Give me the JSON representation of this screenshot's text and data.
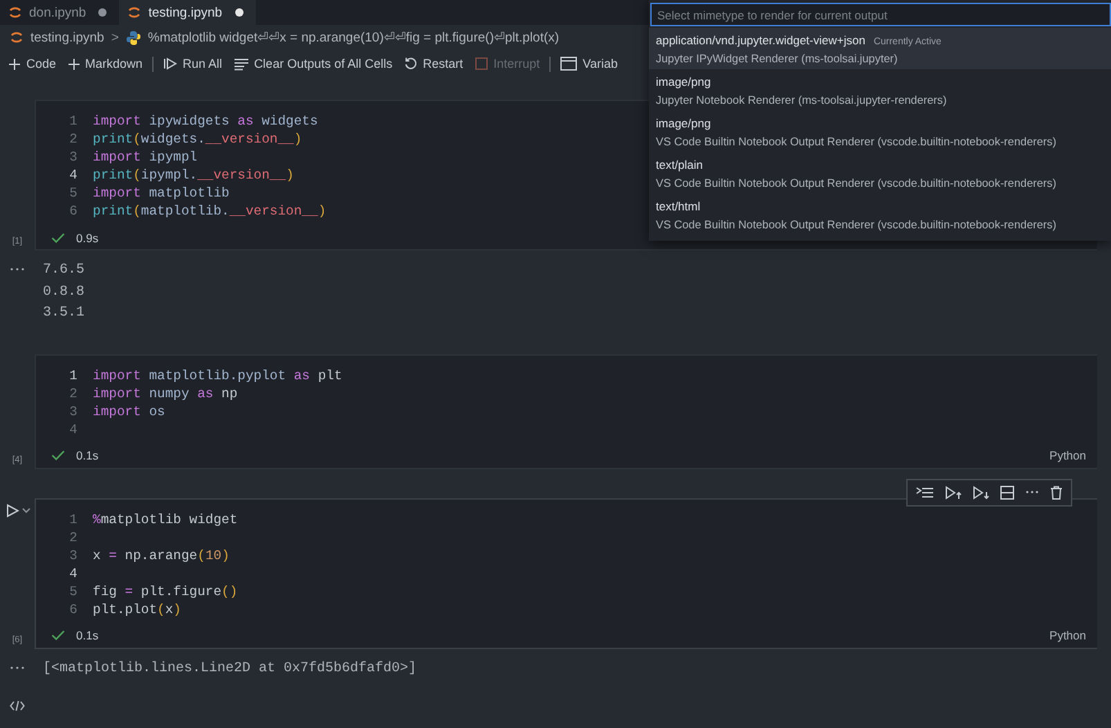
{
  "tabs": [
    {
      "label": "don.ipynb",
      "selected": false,
      "modified": true
    },
    {
      "label": "testing.ipynb",
      "selected": true,
      "modified": true
    }
  ],
  "breadcrumb": {
    "file": "testing.ipynb",
    "separator": ">",
    "cell": "%matplotlib widget⏎⏎x = np.arange(10)⏎⏎fig = plt.figure()⏎plt.plot(x)"
  },
  "toolbar": [
    {
      "kind": "add",
      "label": "Code",
      "disabled": false
    },
    {
      "kind": "add",
      "label": "Markdown",
      "disabled": false
    },
    {
      "kind": "separator"
    },
    {
      "kind": "run-all",
      "label": "Run All",
      "disabled": false
    },
    {
      "kind": "clear",
      "label": "Clear Outputs of All Cells",
      "disabled": false
    },
    {
      "kind": "restart",
      "label": "Restart",
      "disabled": false
    },
    {
      "kind": "interrupt",
      "label": "Interrupt",
      "disabled": true
    },
    {
      "kind": "separator"
    },
    {
      "kind": "variables",
      "label": "Variab",
      "disabled": false
    }
  ],
  "cells": [
    {
      "execution_count": "[1]",
      "time": "0.9s",
      "focused": false,
      "lines": [
        {
          "number": "1",
          "active": false,
          "tokens": [
            {
              "text": "import",
              "kind": "kw"
            },
            {
              "text": " ipywidgets ",
              "kind": "name"
            },
            {
              "text": "as",
              "kind": "kw"
            },
            {
              "text": " widgets",
              "kind": "name"
            }
          ]
        },
        {
          "number": "2",
          "active": false,
          "tokens": [
            {
              "text": "print",
              "kind": "func"
            },
            {
              "text": "(",
              "kind": "paren"
            },
            {
              "text": "widgets.",
              "kind": "name"
            },
            {
              "text": "__version__",
              "kind": "dunder"
            },
            {
              "text": ")",
              "kind": "paren"
            }
          ]
        },
        {
          "number": "3",
          "active": false,
          "tokens": [
            {
              "text": "import",
              "kind": "kw"
            },
            {
              "text": " ipympl",
              "kind": "name"
            }
          ]
        },
        {
          "number": "4",
          "active": true,
          "tokens": [
            {
              "text": "print",
              "kind": "func"
            },
            {
              "text": "(",
              "kind": "paren"
            },
            {
              "text": "ipympl.",
              "kind": "name"
            },
            {
              "text": "__version__",
              "kind": "dunder"
            },
            {
              "text": ")",
              "kind": "paren"
            }
          ]
        },
        {
          "number": "5",
          "active": false,
          "tokens": [
            {
              "text": "import",
              "kind": "kw"
            },
            {
              "text": " matplotlib",
              "kind": "name"
            }
          ]
        },
        {
          "number": "6",
          "active": false,
          "tokens": [
            {
              "text": "print",
              "kind": "func"
            },
            {
              "text": "(",
              "kind": "paren"
            },
            {
              "text": "matplotlib.",
              "kind": "name"
            },
            {
              "text": "__version__",
              "kind": "dunder"
            },
            {
              "text": ")",
              "kind": "paren"
            }
          ]
        }
      ],
      "outputs": [
        "7.6.5",
        "0.8.8",
        "3.5.1"
      ]
    },
    {
      "execution_count": "[4]",
      "time": "0.1s",
      "language": "Python",
      "focused": false,
      "lines": [
        {
          "number": "1",
          "active": true,
          "tokens": [
            {
              "text": "import",
              "kind": "kw"
            },
            {
              "text": " matplotlib.pyplot ",
              "kind": "name"
            },
            {
              "text": "as",
              "kind": "kw"
            },
            {
              "text": " plt",
              "kind": "plain"
            }
          ]
        },
        {
          "number": "2",
          "active": false,
          "tokens": [
            {
              "text": "import",
              "kind": "kw"
            },
            {
              "text": " numpy ",
              "kind": "name"
            },
            {
              "text": "as",
              "kind": "kw"
            },
            {
              "text": " np",
              "kind": "plain"
            }
          ]
        },
        {
          "number": "3",
          "active": false,
          "tokens": [
            {
              "text": "import",
              "kind": "kw"
            },
            {
              "text": " os",
              "kind": "name"
            }
          ]
        },
        {
          "number": "4",
          "active": false
        }
      ]
    },
    {
      "execution_count": "[6]",
      "time": "0.1s",
      "language": "Python",
      "focused": true,
      "lines": [
        {
          "number": "1",
          "active": false,
          "tokens": [
            {
              "text": "%",
              "kind": "kw"
            },
            {
              "text": "matplotlib widget",
              "kind": "plain"
            }
          ]
        },
        {
          "number": "2",
          "active": false
        },
        {
          "number": "3",
          "active": false,
          "tokens": [
            {
              "text": "x ",
              "kind": "plain"
            },
            {
              "text": "=",
              "kind": "kw"
            },
            {
              "text": " np.arange",
              "kind": "plain"
            },
            {
              "text": "(",
              "kind": "paren"
            },
            {
              "text": "10",
              "kind": "number"
            },
            {
              "text": ")",
              "kind": "paren"
            }
          ]
        },
        {
          "number": "4",
          "active": true
        },
        {
          "number": "5",
          "active": false,
          "tokens": [
            {
              "text": "fig ",
              "kind": "plain"
            },
            {
              "text": "=",
              "kind": "kw"
            },
            {
              "text": " plt.figure",
              "kind": "plain"
            },
            {
              "text": "()",
              "kind": "paren"
            }
          ]
        },
        {
          "number": "6",
          "active": false,
          "tokens": [
            {
              "text": "plt.plot",
              "kind": "plain"
            },
            {
              "text": "(",
              "kind": "paren"
            },
            {
              "text": "x",
              "kind": "plain"
            },
            {
              "text": ")",
              "kind": "paren"
            }
          ]
        }
      ],
      "outputs": [
        "[<matplotlib.lines.Line2D at 0x7fd5b6dfafd0>]"
      ],
      "output_end_icon": true
    }
  ],
  "picker": {
    "placeholder": "Select mimetype to render for current output",
    "items": [
      {
        "label": "application/vnd.jupyter.widget-view+json",
        "detail": "Currently Active",
        "description": "Jupyter IPyWidget Renderer (ms-toolsai.jupyter)",
        "selected": true
      },
      {
        "label": "image/png",
        "description": "Jupyter Notebook Renderer (ms-toolsai.jupyter-renderers)",
        "selected": false
      },
      {
        "label": "image/png",
        "description": "VS Code Builtin Notebook Output Renderer (vscode.builtin-notebook-renderers)",
        "selected": false
      },
      {
        "label": "text/plain",
        "description": "VS Code Builtin Notebook Output Renderer (vscode.builtin-notebook-renderers)",
        "selected": false
      },
      {
        "label": "text/html",
        "description": "VS Code Builtin Notebook Output Renderer (vscode.builtin-notebook-renderers)",
        "selected": false
      }
    ]
  }
}
